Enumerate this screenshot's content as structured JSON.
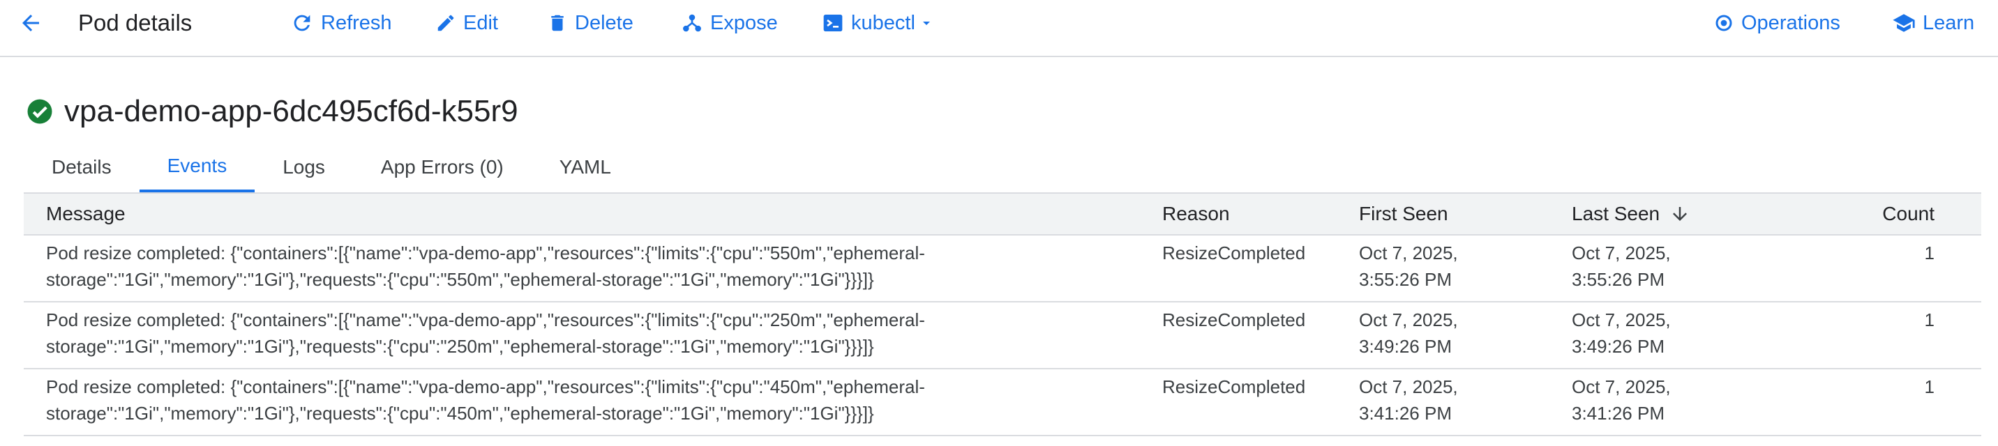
{
  "toolbar": {
    "title": "Pod details",
    "refresh": "Refresh",
    "edit": "Edit",
    "delete": "Delete",
    "expose": "Expose",
    "kubectl": "kubectl",
    "operations": "Operations",
    "learn": "Learn"
  },
  "resource": {
    "name": "vpa-demo-app-6dc495cf6d-k55r9",
    "status_icon": "check-circle-icon",
    "status_color": "#188038"
  },
  "tabs": [
    {
      "label": "Details"
    },
    {
      "label": "Events",
      "active": true
    },
    {
      "label": "Logs"
    },
    {
      "label": "App Errors (0)"
    },
    {
      "label": "YAML"
    }
  ],
  "table": {
    "headers": {
      "message": "Message",
      "reason": "Reason",
      "first_seen": "First Seen",
      "last_seen": "Last Seen",
      "count": "Count"
    },
    "sort_column": "Last Seen",
    "sort_icon": "arrow-down-icon",
    "rows": [
      {
        "message_line1": "Pod resize completed: {\"containers\":[{\"name\":\"vpa-demo-app\",\"resources\":{\"limits\":{\"cpu\":\"550m\",\"ephemeral-",
        "message_line2": "storage\":\"1Gi\",\"memory\":\"1Gi\"},\"requests\":{\"cpu\":\"550m\",\"ephemeral-storage\":\"1Gi\",\"memory\":\"1Gi\"}}}]}",
        "reason": "ResizeCompleted",
        "first_seen_date": "Oct 7, 2025,",
        "first_seen_time": "3:55:26 PM",
        "last_seen_date": "Oct 7, 2025,",
        "last_seen_time": "3:55:26 PM",
        "count": "1"
      },
      {
        "message_line1": "Pod resize completed: {\"containers\":[{\"name\":\"vpa-demo-app\",\"resources\":{\"limits\":{\"cpu\":\"250m\",\"ephemeral-",
        "message_line2": "storage\":\"1Gi\",\"memory\":\"1Gi\"},\"requests\":{\"cpu\":\"250m\",\"ephemeral-storage\":\"1Gi\",\"memory\":\"1Gi\"}}}]}",
        "reason": "ResizeCompleted",
        "first_seen_date": "Oct 7, 2025,",
        "first_seen_time": "3:49:26 PM",
        "last_seen_date": "Oct 7, 2025,",
        "last_seen_time": "3:49:26 PM",
        "count": "1"
      },
      {
        "message_line1": "Pod resize completed: {\"containers\":[{\"name\":\"vpa-demo-app\",\"resources\":{\"limits\":{\"cpu\":\"450m\",\"ephemeral-",
        "message_line2": "storage\":\"1Gi\",\"memory\":\"1Gi\"},\"requests\":{\"cpu\":\"450m\",\"ephemeral-storage\":\"1Gi\",\"memory\":\"1Gi\"}}}]}",
        "reason": "ResizeCompleted",
        "first_seen_date": "Oct 7, 2025,",
        "first_seen_time": "3:41:26 PM",
        "last_seen_date": "Oct 7, 2025,",
        "last_seen_time": "3:41:26 PM",
        "count": "1"
      }
    ]
  },
  "colors": {
    "accent": "#1a73e8",
    "border": "#dadce0",
    "header_bg": "#f1f3f4"
  }
}
